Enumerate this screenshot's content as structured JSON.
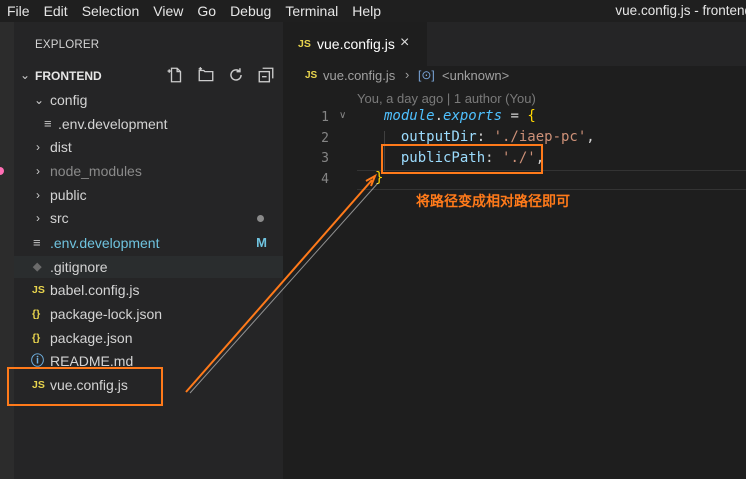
{
  "menubar": {
    "items": [
      "File",
      "Edit",
      "Selection",
      "View",
      "Go",
      "Debug",
      "Terminal",
      "Help"
    ],
    "window_title": "vue.config.js - frontend"
  },
  "explorer": {
    "title": "EXPLORER",
    "section_label": "FRONTEND",
    "actions": [
      "new-file-icon",
      "new-folder-icon",
      "refresh-icon",
      "collapse-all-icon"
    ],
    "items": [
      {
        "type": "folder",
        "label": "config",
        "expanded": true,
        "depth": 0
      },
      {
        "type": "file",
        "label": ".env.development",
        "icon": "≡",
        "depth": 1
      },
      {
        "type": "folder",
        "label": "dist",
        "expanded": false,
        "depth": 0
      },
      {
        "type": "folder",
        "label": "node_modules",
        "expanded": false,
        "depth": 0,
        "dimmed": true
      },
      {
        "type": "folder",
        "label": "public",
        "expanded": false,
        "depth": 0
      },
      {
        "type": "folder",
        "label": "src",
        "expanded": false,
        "depth": 0,
        "modified_dot": true
      },
      {
        "type": "file",
        "label": ".env.development",
        "icon": "≡",
        "depth": 0,
        "status": "M"
      },
      {
        "type": "file",
        "label": ".gitignore",
        "icon": "◆",
        "depth": 0
      },
      {
        "type": "file",
        "label": "babel.config.js",
        "icon": "JS",
        "depth": 0
      },
      {
        "type": "file",
        "label": "package-lock.json",
        "icon": "{}",
        "depth": 0
      },
      {
        "type": "file",
        "label": "package.json",
        "icon": "{}",
        "depth": 0
      },
      {
        "type": "file",
        "label": "README.md",
        "icon": "ⓘ",
        "depth": 0
      },
      {
        "type": "file",
        "label": "vue.config.js",
        "icon": "JS",
        "depth": 0,
        "selected": true
      }
    ]
  },
  "editor": {
    "tab": {
      "icon": "JS",
      "label": "vue.config.js",
      "close": "×"
    },
    "breadcrumbs": {
      "file_icon": "JS",
      "file": "vue.config.js",
      "separator": "›",
      "symbol": "<unknown>"
    },
    "blame": "You, a day ago | 1 author (You)",
    "line_numbers": [
      "1",
      "2",
      "3",
      "4"
    ],
    "code": {
      "line1": {
        "mod": "module",
        "dot": ".",
        "prop": "exports",
        "eq": " = ",
        "brace": "{"
      },
      "line2": {
        "key": "outputDir",
        "colon": ": ",
        "value": "'./iaep-pc'",
        "comma": ","
      },
      "line3": {
        "key": "publicPath",
        "colon": ": ",
        "value": "'./'",
        "comma": ","
      },
      "line4": {
        "brace": "}"
      }
    }
  },
  "annotation": {
    "text": "将路径变成相对路径即可",
    "color": "#ff7a1a"
  },
  "colors": {
    "accent_js": "#e8d44d",
    "modified": "#6fc3df",
    "annotation": "#ff7a1a"
  }
}
